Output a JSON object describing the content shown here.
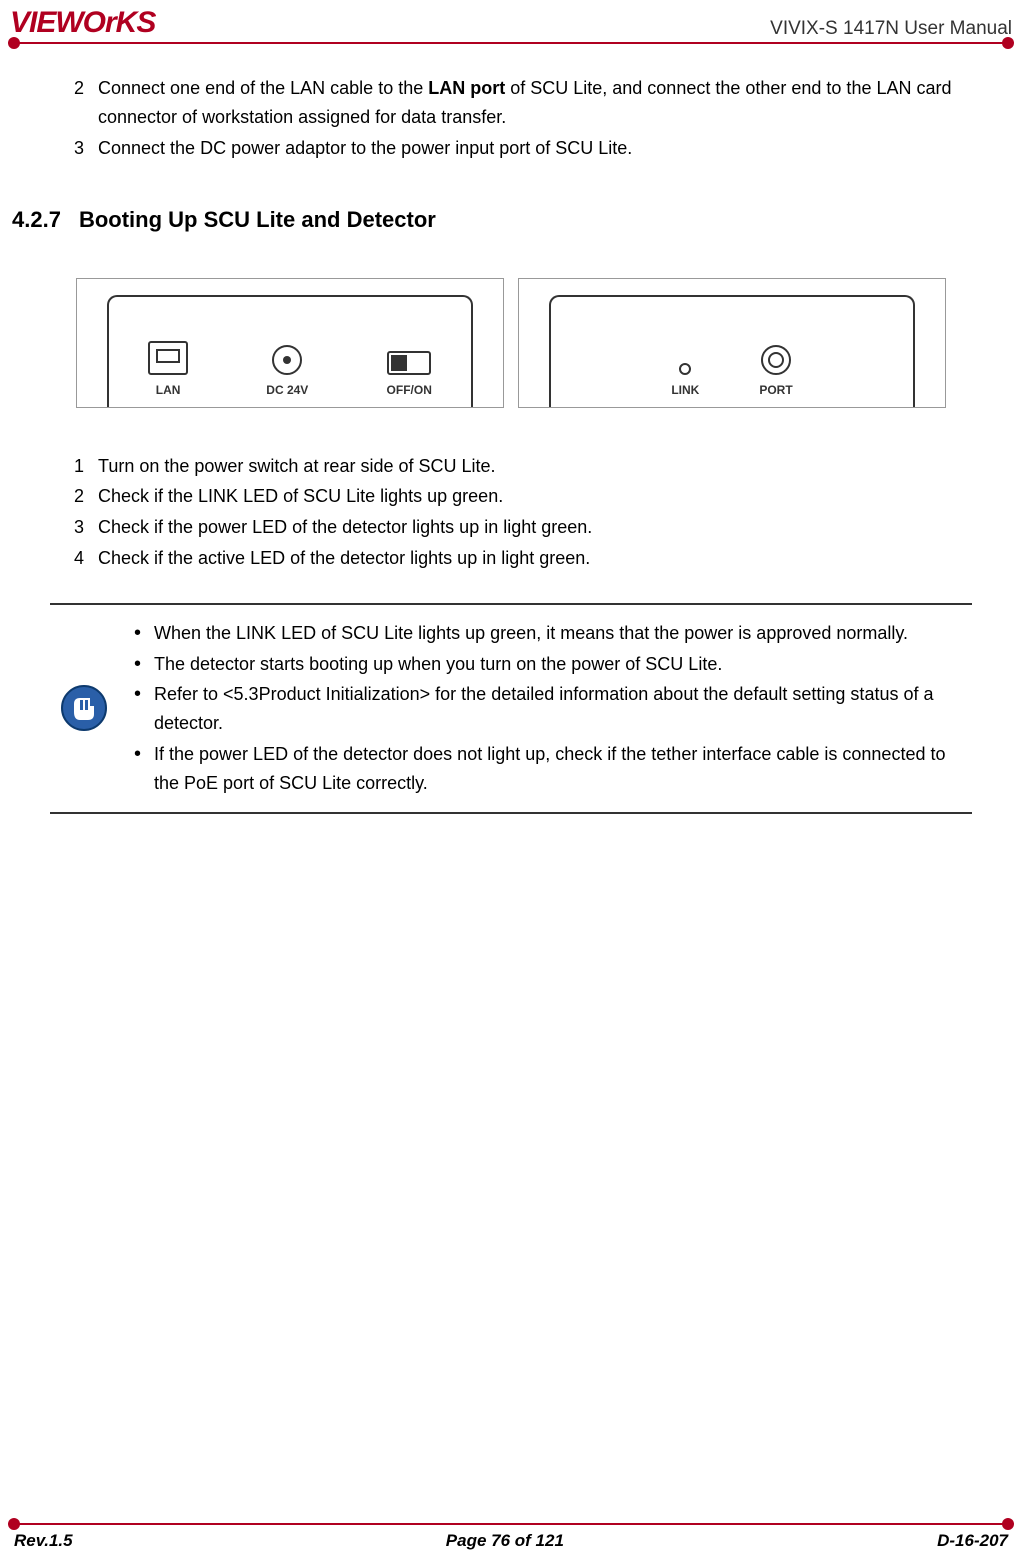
{
  "header": {
    "logo_text": "VIEWOrKS",
    "doc_title": "VIVIX-S 1417N User Manual"
  },
  "intro_list": [
    {
      "num": "2",
      "text_pre": "Connect one end of the LAN cable to the ",
      "bold": "LAN port",
      "text_post": " of SCU Lite, and connect the other end to the LAN card connector of workstation assigned for data transfer."
    },
    {
      "num": "3",
      "text_pre": "Connect the DC power adaptor to the power input port of SCU Lite.",
      "bold": "",
      "text_post": ""
    }
  ],
  "section": {
    "number": "4.2.7",
    "title": "Booting Up SCU Lite and Detector"
  },
  "diagram_labels": {
    "left": {
      "lan": "LAN",
      "dc": "DC 24V",
      "sw": "OFF/ON"
    },
    "right": {
      "link": "LINK",
      "port": "PORT"
    }
  },
  "step_list": [
    {
      "num": "1",
      "text": "Turn on the power switch at rear side of SCU Lite."
    },
    {
      "num": "2",
      "text": "Check if the LINK LED of SCU Lite lights up green."
    },
    {
      "num": "3",
      "text": "Check if the power LED of the detector lights up in light green."
    },
    {
      "num": "4",
      "text": "Check if the active LED of the detector lights up in light green."
    }
  ],
  "notes": [
    "When the LINK LED of SCU Lite lights up green, it means that the power is approved normally.",
    "The detector starts booting up when you turn on the power of SCU Lite.",
    "Refer to <5.3Product Initialization> for the detailed information about the default setting status of a detector.",
    "If the power LED of the detector does not light up, check if the tether interface cable is connected to the PoE port of SCU Lite correctly."
  ],
  "footer": {
    "rev": "Rev.1.5",
    "page": "Page 76 of 121",
    "doc_id": "D-16-207"
  }
}
